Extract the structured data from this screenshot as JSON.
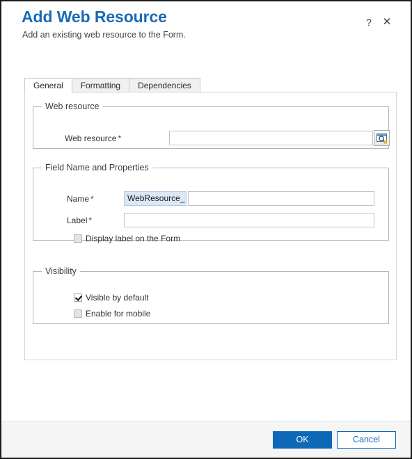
{
  "window": {
    "title": "Add Web Resource",
    "subtitle": "Add an existing web resource to the Form.",
    "help_icon": "?",
    "close_icon": "✕",
    "accent_color": "#1a6bb5",
    "primary_button_color": "#0d68b8",
    "required_marker_color": "#a52121"
  },
  "tabs": [
    {
      "label": "General",
      "active": true
    },
    {
      "label": "Formatting",
      "active": false
    },
    {
      "label": "Dependencies",
      "active": false
    }
  ],
  "groups": {
    "web_resource": {
      "legend": "Web resource",
      "field_label": "Web resource",
      "required_marker": "*",
      "value": "",
      "placeholder": "",
      "lookup_icon": "lookup-browse-icon"
    },
    "field_name_and_properties": {
      "legend": "Field Name and Properties",
      "name_label": "Name",
      "name_required_marker": "*",
      "name_prefix": "WebResource_",
      "name_value": "",
      "label_label": "Label",
      "label_required_marker": "*",
      "label_value": "",
      "display_label_checkbox": {
        "label": "Display label on the Form",
        "checked": false,
        "disabled": true
      }
    },
    "visibility": {
      "legend": "Visibility",
      "visible_by_default": {
        "label": "Visible by default",
        "checked": true,
        "disabled": false
      },
      "enable_for_mobile": {
        "label": "Enable for mobile",
        "checked": false,
        "disabled": true
      }
    }
  },
  "footer": {
    "ok_label": "OK",
    "cancel_label": "Cancel"
  }
}
